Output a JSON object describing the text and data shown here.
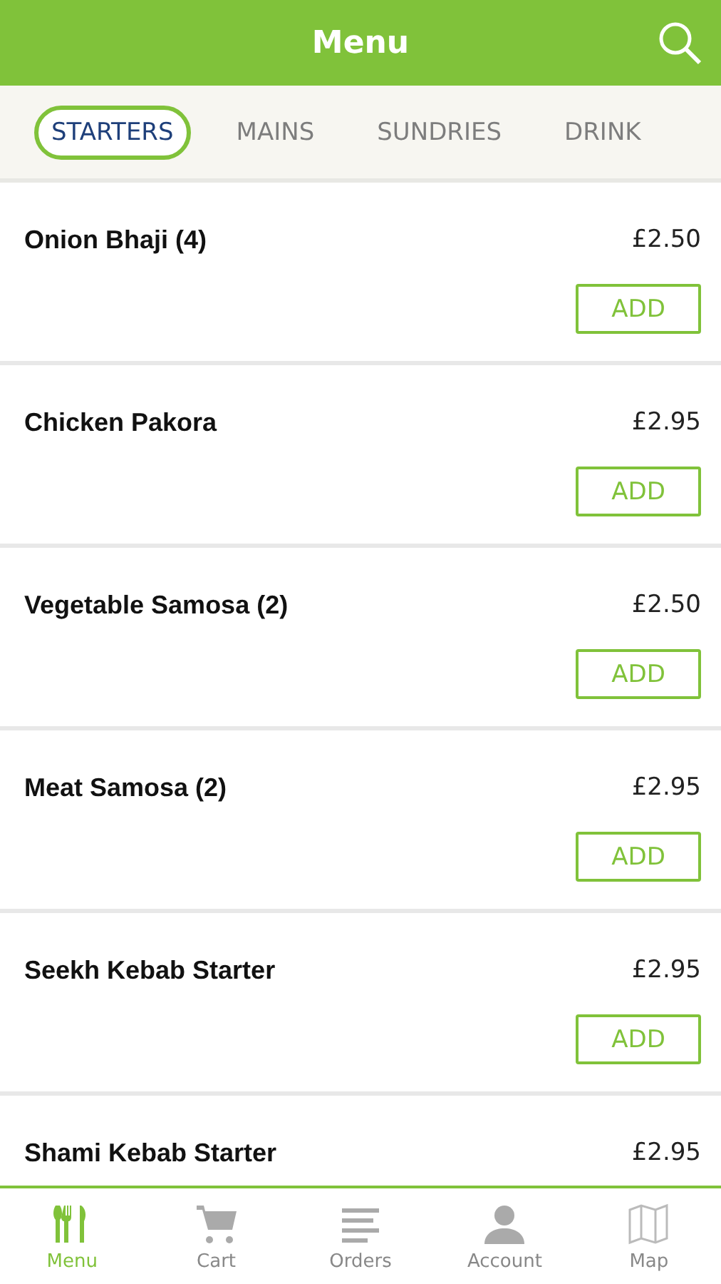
{
  "header": {
    "title": "Menu"
  },
  "tabs": [
    {
      "label": "STARTERS",
      "selected": true
    },
    {
      "label": "MAINS",
      "selected": false
    },
    {
      "label": "SUNDRIES",
      "selected": false
    },
    {
      "label": "DRINK",
      "selected": false
    }
  ],
  "items": [
    {
      "name": "Onion Bhaji (4)",
      "price": "£2.50",
      "button": "ADD"
    },
    {
      "name": "Chicken Pakora",
      "price": "£2.95",
      "button": "ADD"
    },
    {
      "name": "Vegetable Samosa (2)",
      "price": "£2.50",
      "button": "ADD"
    },
    {
      "name": "Meat Samosa (2)",
      "price": "£2.95",
      "button": "ADD"
    },
    {
      "name": "Seekh Kebab Starter",
      "price": "£2.95",
      "button": "ADD"
    },
    {
      "name": "Shami Kebab Starter",
      "price": "£2.95"
    }
  ],
  "nav": [
    {
      "kind": "menu",
      "label": "Menu",
      "selected": true
    },
    {
      "kind": "cart",
      "label": "Cart",
      "selected": false
    },
    {
      "kind": "orders",
      "label": "Orders",
      "selected": false
    },
    {
      "kind": "account",
      "label": "Account",
      "selected": false
    },
    {
      "kind": "map",
      "label": "Map",
      "selected": false
    }
  ]
}
